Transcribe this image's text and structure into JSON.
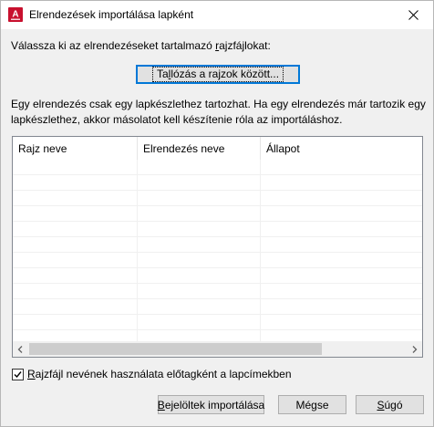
{
  "window": {
    "title": "Elrendezések importálása lapként",
    "icon": "autocad-icon",
    "close_glyph": "✕",
    "accent_color": "#c8102e"
  },
  "instruction": {
    "pre": "Válassza ki az elrendezéseket tartalmazó ",
    "accel": "r",
    "post": "ajzfájlokat:"
  },
  "browse_button": {
    "pre": "Ta",
    "accel": "l",
    "post": "lózás a rajzok között..."
  },
  "note": "Egy elrendezés csak egy lapkészlethez tartozhat. Ha egy elrendezés már tartozik egy lapkészlethez, akkor másolatot kell készítenie róla az importáláshoz.",
  "table": {
    "columns": [
      "Rajz neve",
      "Elrendezés neve",
      "Állapot"
    ],
    "rows": []
  },
  "checkbox": {
    "pre": "",
    "accel": "R",
    "post": "ajzfájl nevének használata előtagként a lapcímekben",
    "checked": true
  },
  "buttons": {
    "import": {
      "pre": "",
      "accel": "B",
      "post": "ejelöltek importálása"
    },
    "cancel": {
      "label": "Mégse"
    },
    "help": {
      "pre": "",
      "accel": "S",
      "post": "úgó"
    }
  }
}
